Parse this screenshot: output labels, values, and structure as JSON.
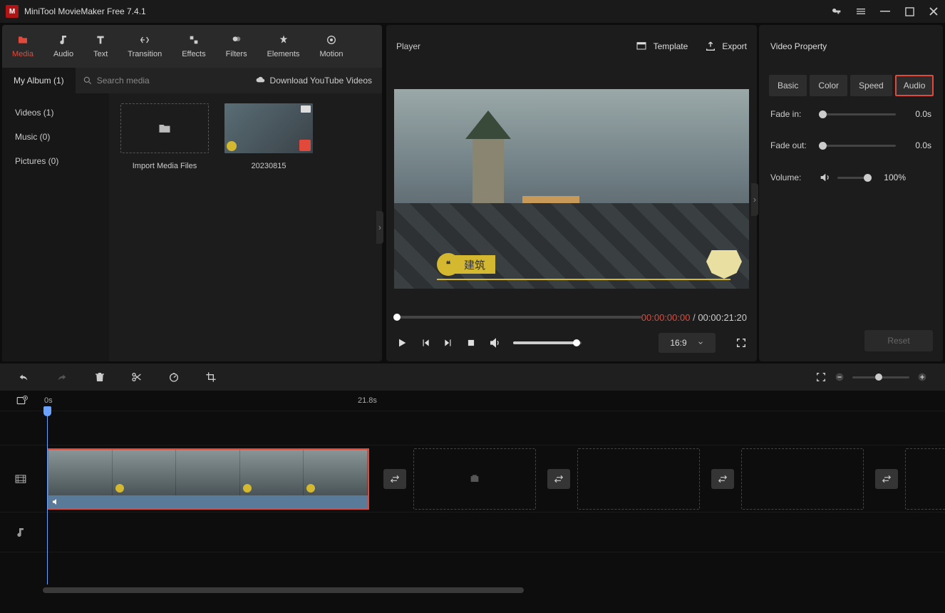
{
  "app": {
    "title": "MiniTool MovieMaker Free 7.4.1"
  },
  "ribbon": {
    "items": [
      {
        "label": "Media",
        "active": true
      },
      {
        "label": "Audio"
      },
      {
        "label": "Text"
      },
      {
        "label": "Transition"
      },
      {
        "label": "Effects"
      },
      {
        "label": "Filters"
      },
      {
        "label": "Elements"
      },
      {
        "label": "Motion"
      }
    ]
  },
  "media": {
    "album_tab": "My Album (1)",
    "search_placeholder": "Search media",
    "download_label": "Download YouTube Videos",
    "sidebar": [
      {
        "label": "Videos (1)"
      },
      {
        "label": "Music (0)"
      },
      {
        "label": "Pictures (0)"
      }
    ],
    "import_label": "Import Media Files",
    "clip_name": "20230815"
  },
  "player": {
    "title": "Player",
    "template_label": "Template",
    "export_label": "Export",
    "caption_text": "建筑",
    "time_current": "00:00:00:00",
    "time_sep": " / ",
    "time_total": "00:00:21:20",
    "aspect": "16:9"
  },
  "property": {
    "title": "Video Property",
    "tabs": [
      {
        "label": "Basic"
      },
      {
        "label": "Color"
      },
      {
        "label": "Speed"
      },
      {
        "label": "Audio",
        "active": true
      }
    ],
    "fadein_label": "Fade in:",
    "fadein_value": "0.0s",
    "fadeout_label": "Fade out:",
    "fadeout_value": "0.0s",
    "volume_label": "Volume:",
    "volume_value": "100%",
    "reset_label": "Reset"
  },
  "timeline": {
    "ruler_start": "0s",
    "ruler_mid": "21.8s"
  }
}
